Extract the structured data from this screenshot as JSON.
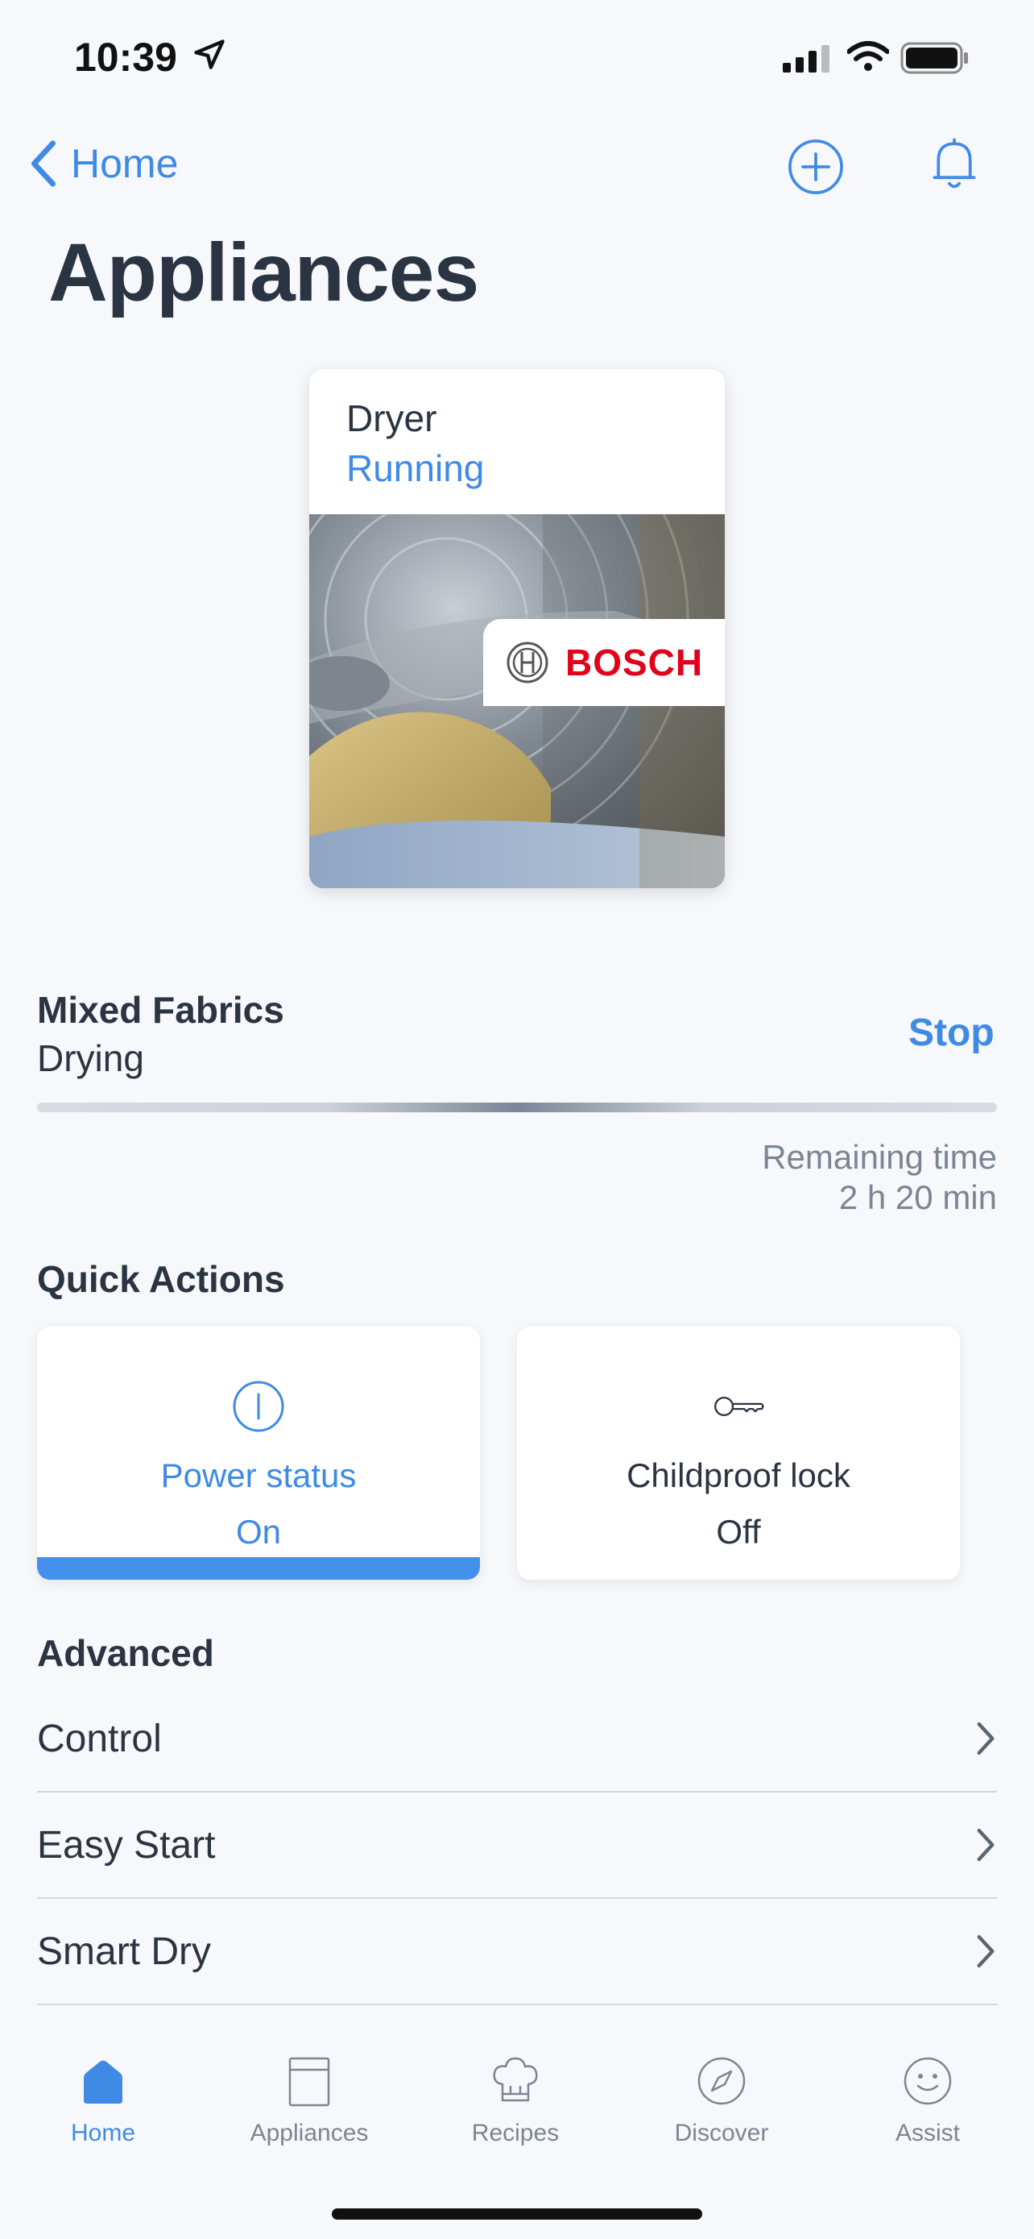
{
  "status_bar": {
    "time": "10:39"
  },
  "nav": {
    "back_label": "Home"
  },
  "page": {
    "title": "Appliances"
  },
  "appliance": {
    "name": "Dryer",
    "status": "Running",
    "brand": "BOSCH"
  },
  "program": {
    "name": "Mixed Fabrics",
    "phase": "Drying",
    "stop_label": "Stop",
    "remaining_label": "Remaining time",
    "remaining_value": "2 h 20 min"
  },
  "quick_actions": {
    "title": "Quick Actions",
    "items": [
      {
        "label": "Power status",
        "value": "On",
        "icon": "power-icon",
        "active": true
      },
      {
        "label": "Childproof lock",
        "value": "Off",
        "icon": "key-icon",
        "active": false
      }
    ]
  },
  "advanced": {
    "title": "Advanced",
    "items": [
      {
        "label": "Control"
      },
      {
        "label": "Easy Start"
      },
      {
        "label": "Smart Dry"
      }
    ]
  },
  "tabs": [
    {
      "label": "Home",
      "icon": "home-icon",
      "active": true
    },
    {
      "label": "Appliances",
      "icon": "appliances-icon",
      "active": false
    },
    {
      "label": "Recipes",
      "icon": "chef-hat-icon",
      "active": false
    },
    {
      "label": "Discover",
      "icon": "compass-icon",
      "active": false
    },
    {
      "label": "Assist",
      "icon": "smiley-icon",
      "active": false
    }
  ],
  "colors": {
    "accent": "#3f8ae4",
    "text": "#2b3442",
    "muted": "#7b8594",
    "brand": "#e2001a"
  }
}
